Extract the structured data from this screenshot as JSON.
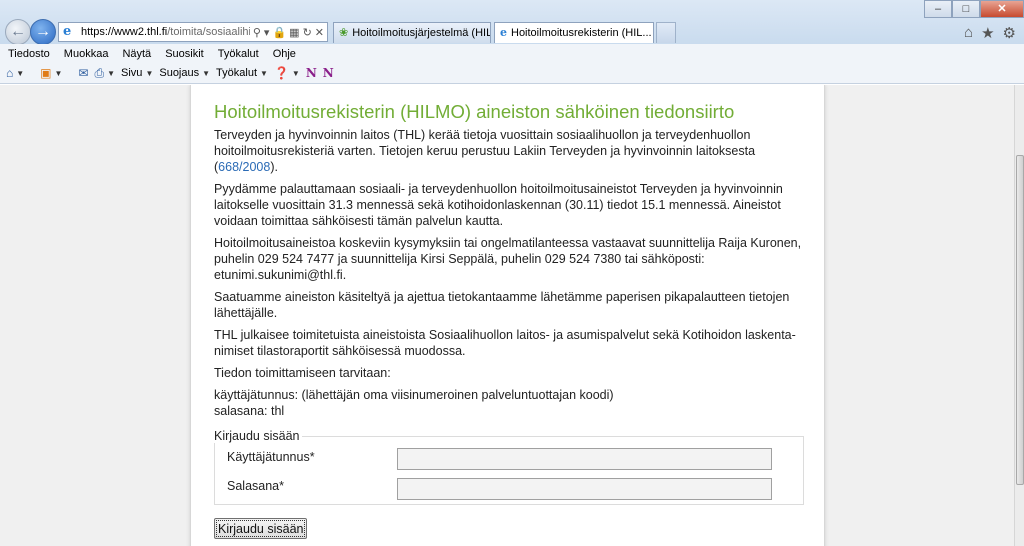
{
  "browser": {
    "url_host": "https://www2.thl.fi",
    "url_path": "/toimita/sosiaalihilm",
    "tabs": [
      {
        "title": "Hoitoilmoitusjärjestelmä (HIL..."
      },
      {
        "title": "Hoitoilmoitusrekisterin (HIL...",
        "active": true
      }
    ],
    "menu": [
      "Tiedosto",
      "Muokkaa",
      "Näytä",
      "Suosikit",
      "Työkalut",
      "Ohje"
    ],
    "commands": {
      "page": "Sivu",
      "safety": "Suojaus",
      "tools": "Työkalut"
    },
    "icons": {
      "back": "back-arrow-icon",
      "forward": "forward-arrow-icon",
      "home": "home-icon",
      "favorites": "star-icon",
      "settings": "gear-icon"
    }
  },
  "page": {
    "title": "Hoitoilmoitusrekisterin (HILMO) aineiston sähköinen tiedonsiirto",
    "p1_text": "Terveyden ja hyvinvoinnin laitos (THL) kerää tietoja vuosittain sosiaalihuollon ja terveydenhuollon hoitoilmoitusrekisteriä varten. Tietojen keruu perustuu Lakiin Terveyden ja hyvinvoinnin laitoksesta (",
    "p1_link": "668/2008",
    "p1_end": ").",
    "p2": "Pyydämme palauttamaan sosiaali- ja terveydenhuollon hoitoilmoitusaineistot Terveyden ja hyvinvoinnin laitokselle vuosittain 31.3 mennessä sekä kotihoidonlaskennan (30.11) tiedot 15.1 mennessä. Aineistot voidaan toimittaa sähköisesti tämän palvelun kautta.",
    "p3": "Hoitoilmoitusaineistoa koskeviin kysymyksiin tai ongelmatilanteessa vastaavat suunnittelija Raija Kuronen, puhelin 029 524 7477 ja suunnittelija Kirsi Seppälä, puhelin 029 524 7380 tai sähköposti: etunimi.sukunimi@thl.fi.",
    "p4": "Saatuamme aineiston käsiteltyä ja ajettua tietokantaamme lähetämme paperisen pikapalautteen tietojen lähettäjälle.",
    "p5": "THL julkaisee toimitetuista aineistoista Sosiaalihuollon laitos- ja asumispalvelut sekä Kotihoidon laskenta-nimiset tilastoraportit sähköisessä muodossa.",
    "p6": "Tiedon toimittamiseen tarvitaan:",
    "p7_line1": "käyttäjätunnus: (lähettäjän oma viisinumeroinen palveluntuottajan koodi)",
    "p7_line2": "salasana: thl"
  },
  "login": {
    "legend": "Kirjaudu sisään",
    "username_label": "Käyttäjätunnus*",
    "username_value": "",
    "password_label": "Salasana*",
    "password_value": "",
    "submit_label": "Kirjaudu sisään"
  }
}
